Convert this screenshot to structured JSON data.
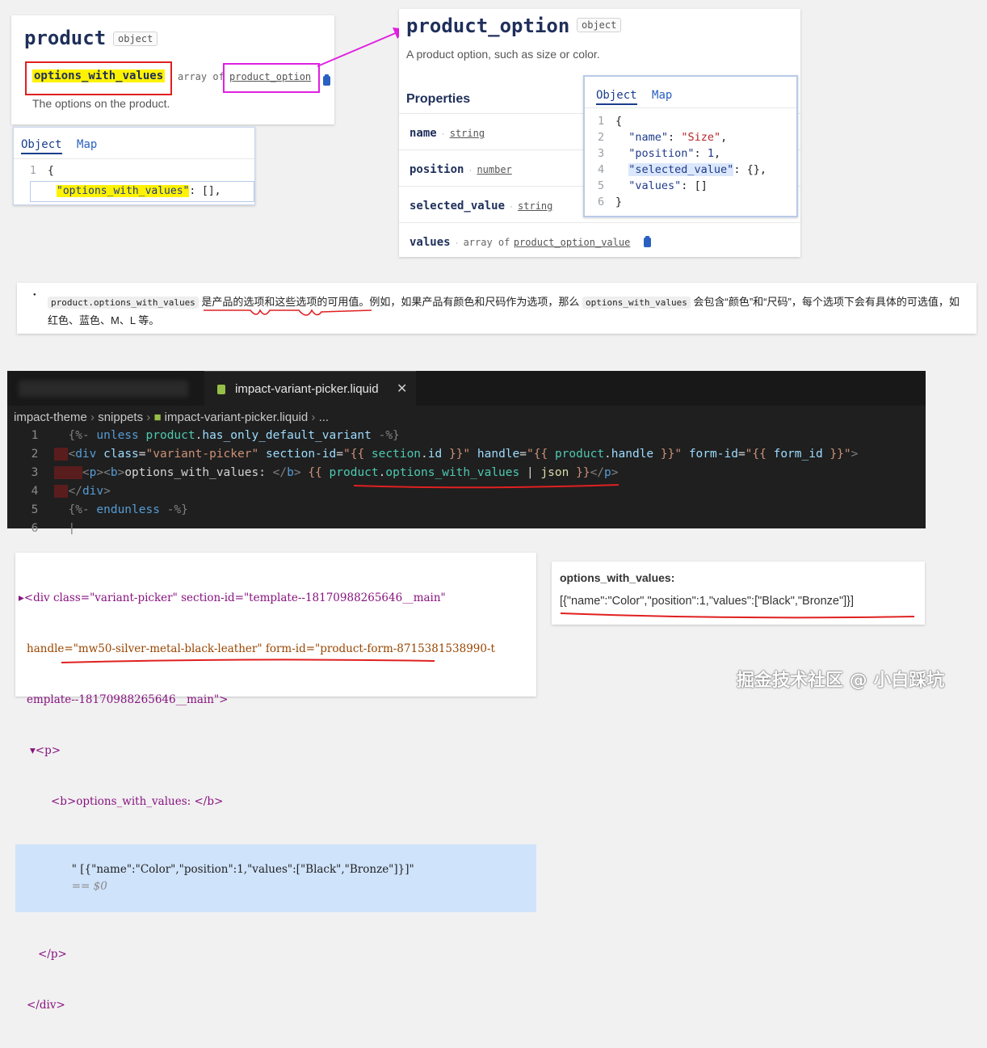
{
  "product_card": {
    "title": "product",
    "badge": "object",
    "prop_name": "options_with_values",
    "array_of": "array of",
    "type_link": "product_option",
    "description": "The options on the product.",
    "popup": {
      "tabs": [
        "Object",
        "Map"
      ],
      "line1_num": "1",
      "line1": "{",
      "line2_key": "\"options_with_values\"",
      "line2_rest": ": [],"
    }
  },
  "option_card": {
    "title": "product_option",
    "badge": "object",
    "description": "A product option, such as size or color.",
    "properties_heading": "Properties",
    "rows": [
      {
        "name": "name",
        "type": "string"
      },
      {
        "name": "position",
        "type": "number"
      },
      {
        "name": "selected_value",
        "type": "string"
      },
      {
        "name": "values",
        "type_prefix": "array of",
        "type": "product_option_value"
      }
    ],
    "popup": {
      "tabs": [
        "Object",
        "Map"
      ],
      "lines": [
        {
          "n": "1",
          "text": "{"
        },
        {
          "n": "2",
          "key": "\"name\"",
          "sep": ": ",
          "val": "\"Size\"",
          "end": ","
        },
        {
          "n": "3",
          "key": "\"position\"",
          "sep": ": ",
          "val": "1",
          "end": ","
        },
        {
          "n": "4",
          "key": "\"selected_value\"",
          "sep": ": ",
          "val": "{}",
          "end": ","
        },
        {
          "n": "5",
          "key": "\"values\"",
          "sep": ": ",
          "val": "[]",
          "end": ""
        },
        {
          "n": "6",
          "text": "}"
        }
      ]
    }
  },
  "note": {
    "code1": "product.options_with_values",
    "text1": " 是产品的选项和这些选项的可用值。例如，如果产品有颜色和尺码作为选项，那么 ",
    "code2": "options_with_values",
    "text2": " 会包含“颜色”和“尺码”，每个选项下会有具体的可选值，如红色、蓝色、M、L 等。"
  },
  "editor": {
    "tab_label": "impact-variant-picker.liquid",
    "breadcrumb": [
      "impact-theme",
      "snippets",
      "impact-variant-picker.liquid",
      "..."
    ],
    "lines": [
      "1",
      "2",
      "3",
      "4",
      "5",
      "6"
    ]
  },
  "devtools": {
    "line1": "<div class=\"variant-picker\" section-id=\"template--18170988265646__main\"",
    "line2": "handle=\"mw50-silver-metal-black-leather\" form-id=\"product-form-8715381538990-t",
    "line3": "emplate--18170988265646__main\">",
    "line4": "<p>",
    "line5": "<b>options_with_values: </b>",
    "line6": "\" [{\"name\":\"Color\",\"position\":1,\"values\":[\"Black\",\"Bronze\"]}]\"",
    "line6_suffix": "== $0",
    "line7": "</p>",
    "line8": "</div>"
  },
  "output": {
    "label": "options_with_values:",
    "value": "[{\"name\":\"Color\",\"position\":1,\"values\":[\"Black\",\"Bronze\"]}]"
  },
  "watermark": "掘金技术社区 @ 小白踩坑",
  "colors": {
    "annotation_red": "#e02020",
    "annotation_magenta": "#e020e0"
  }
}
